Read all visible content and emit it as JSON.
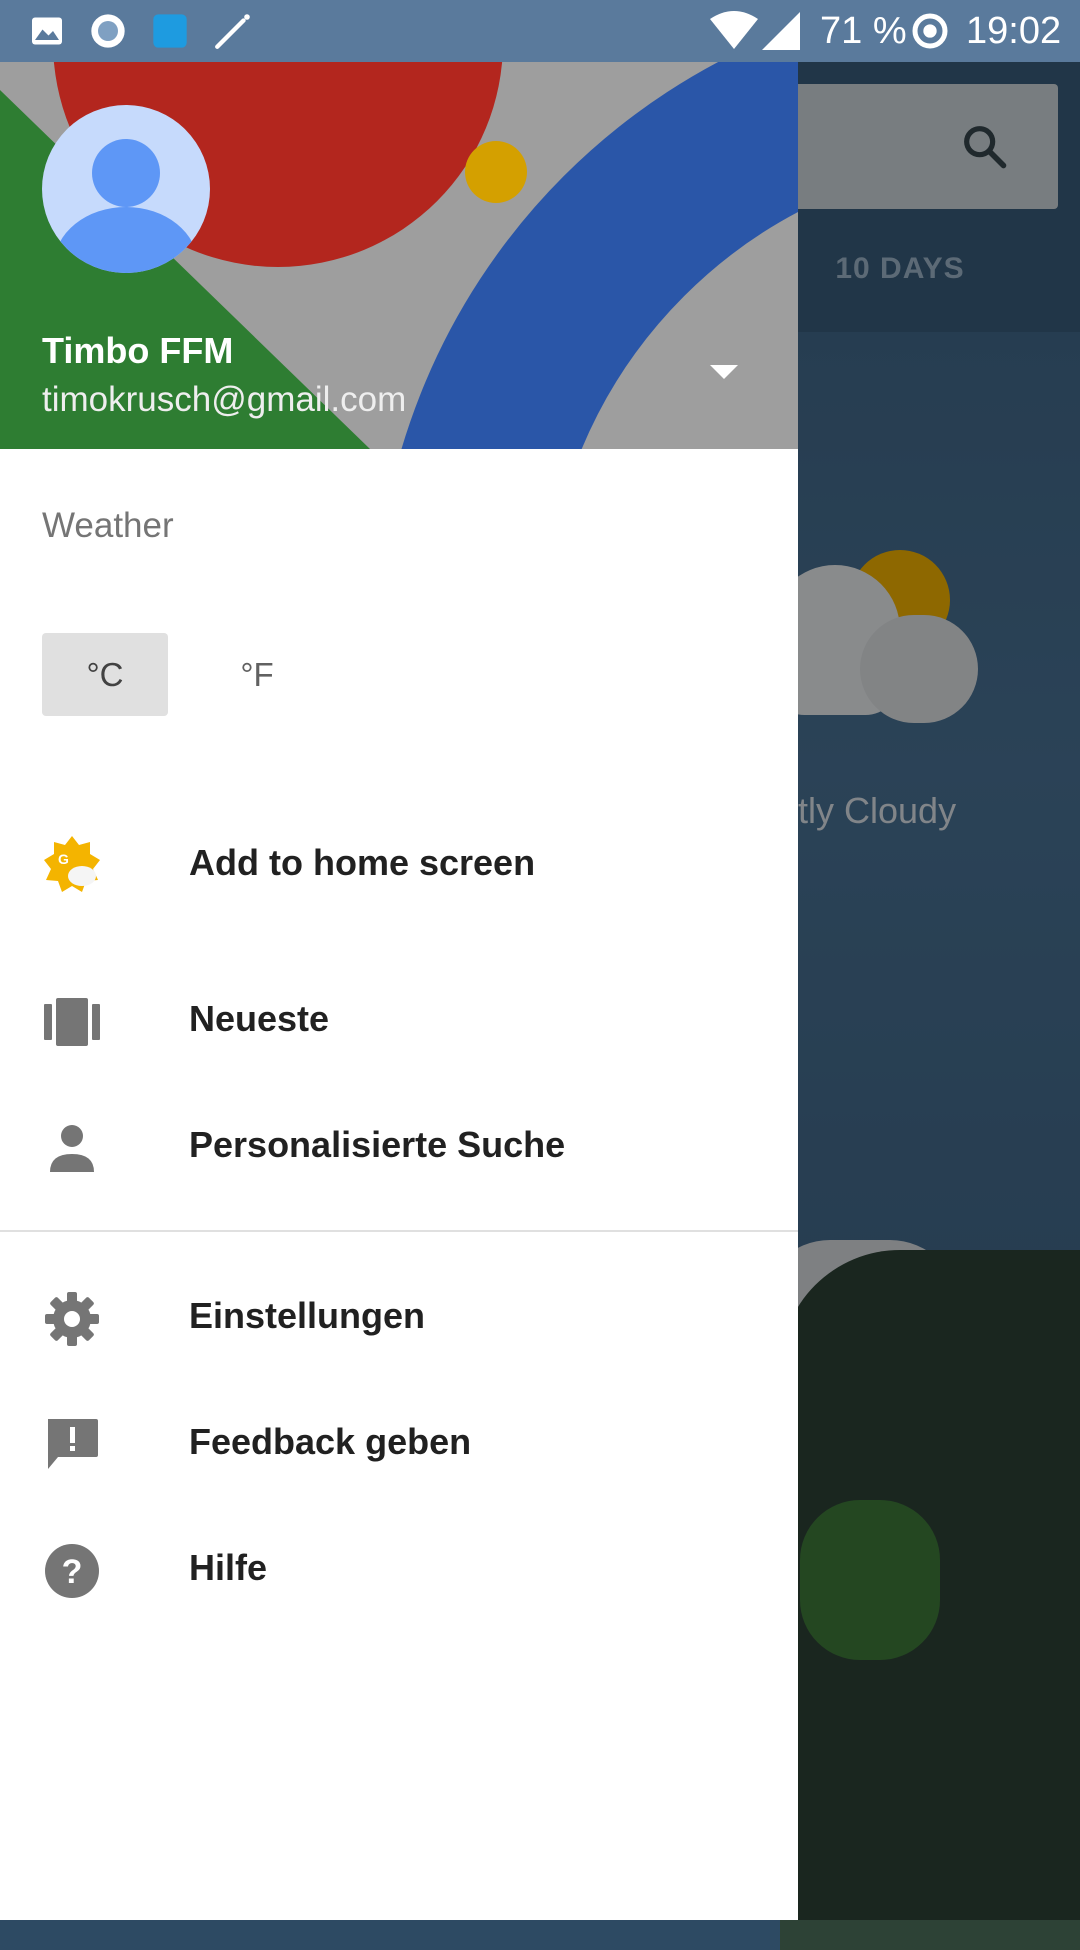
{
  "status_bar": {
    "battery": "71 %",
    "time": "19:02",
    "icons": [
      "image-icon",
      "record-icon",
      "app-square-icon",
      "magic-wand-icon",
      "wifi-icon",
      "signal-icon",
      "battery-saver-icon"
    ]
  },
  "background": {
    "tab_label": "10 DAYS",
    "condition": "stly Cloudy"
  },
  "drawer": {
    "account": {
      "name": "Timbo FFM",
      "email": "timokrusch@gmail.com"
    },
    "section_title": "Weather",
    "units": {
      "celsius": "°C",
      "fahrenheit": "°F",
      "selected": "celsius"
    },
    "items": [
      {
        "label": "Add to home screen",
        "icon": "weather-app-icon"
      },
      {
        "label": "Neueste",
        "icon": "carousel-icon"
      },
      {
        "label": "Personalisierte Suche",
        "icon": "person-icon"
      },
      {
        "label": "Einstellungen",
        "icon": "gear-icon"
      },
      {
        "label": "Feedback geben",
        "icon": "feedback-icon"
      },
      {
        "label": "Hilfe",
        "icon": "help-icon"
      }
    ]
  },
  "colors": {
    "header_green": "#2e7d32",
    "header_red": "#b3261e",
    "header_blue": "#2a56a8",
    "header_yellow": "#d4a000",
    "avatar_blue": "#5e97f6"
  }
}
